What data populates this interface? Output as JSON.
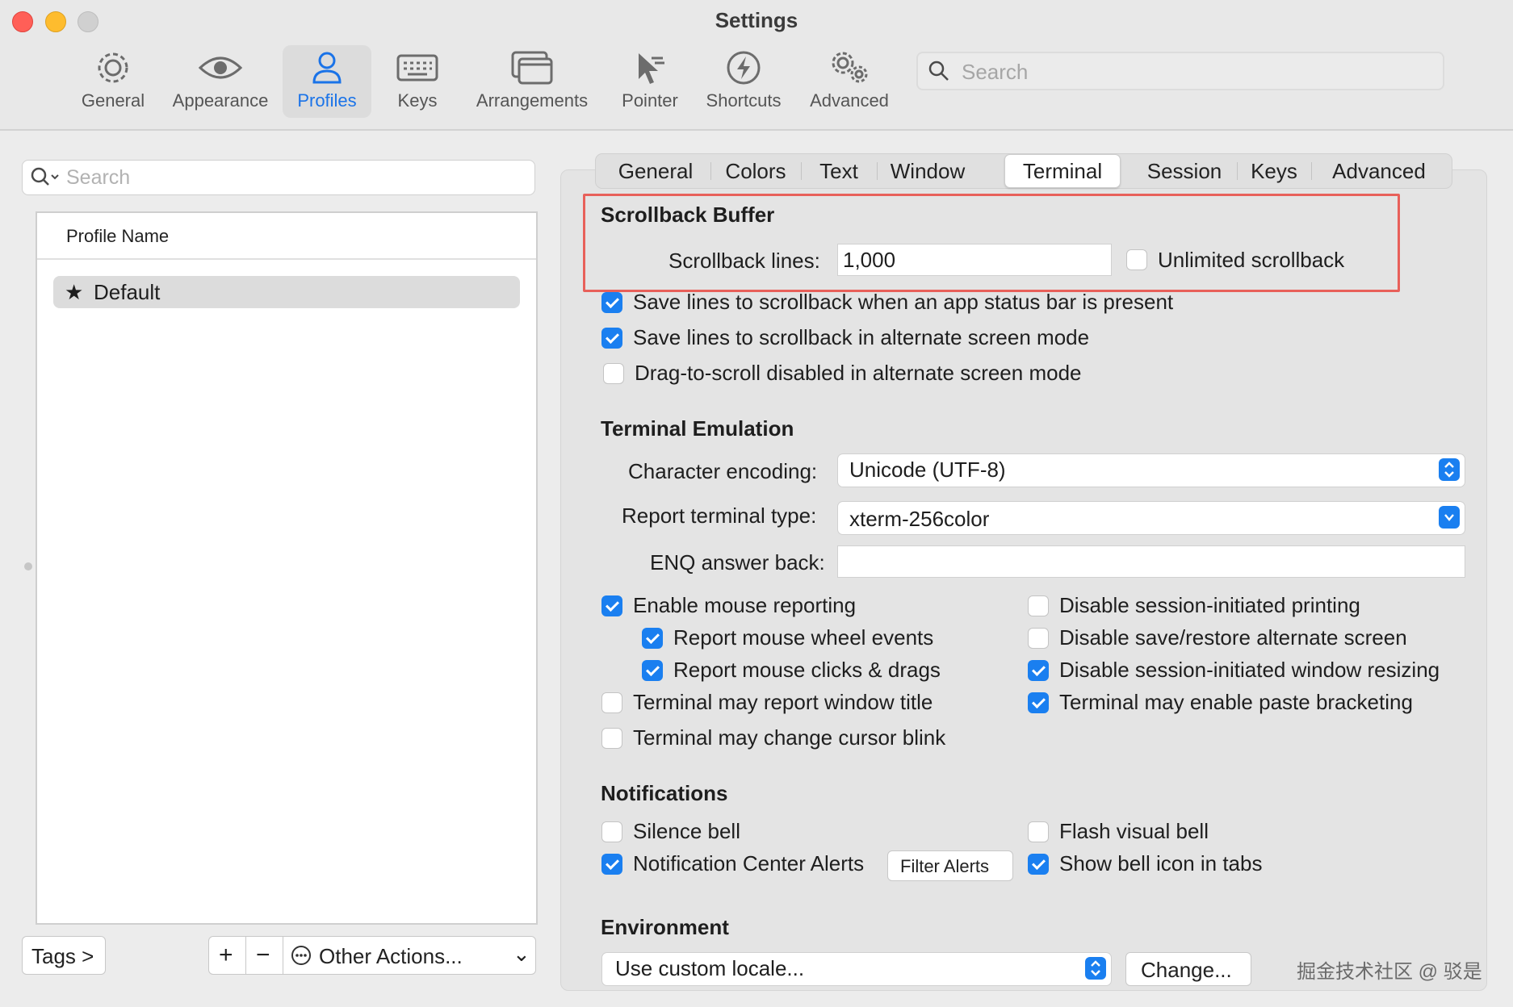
{
  "window": {
    "title": "Settings"
  },
  "toolbar": {
    "items": [
      {
        "label": "General",
        "icon": "gear-icon"
      },
      {
        "label": "Appearance",
        "icon": "eye-icon"
      },
      {
        "label": "Profiles",
        "icon": "person-icon",
        "selected": true
      },
      {
        "label": "Keys",
        "icon": "keyboard-icon"
      },
      {
        "label": "Arrangements",
        "icon": "windows-icon"
      },
      {
        "label": "Pointer",
        "icon": "cursor-icon"
      },
      {
        "label": "Shortcuts",
        "icon": "bolt-icon"
      },
      {
        "label": "Advanced",
        "icon": "gears-icon"
      }
    ],
    "search_placeholder": "Search"
  },
  "sidebar": {
    "search_placeholder": "Search",
    "column_header": "Profile Name",
    "profiles": [
      {
        "name": "Default",
        "default": true
      }
    ],
    "tags_label": "Tags >",
    "add_label": "+",
    "remove_label": "−",
    "other_actions_label": "Other Actions...",
    "other_actions_caret": "⌄"
  },
  "tabs": [
    "General",
    "Colors",
    "Text",
    "Window",
    "Terminal",
    "Session",
    "Keys",
    "Advanced"
  ],
  "selected_tab": "Terminal",
  "scrollback": {
    "title": "Scrollback Buffer",
    "lines_label": "Scrollback lines:",
    "lines_value": "1,000",
    "unlimited_label": "Unlimited scrollback",
    "unlimited_checked": false,
    "options": [
      {
        "label": "Save lines to scrollback when an app status bar is present",
        "checked": true
      },
      {
        "label": "Save lines to scrollback in alternate screen mode",
        "checked": true
      },
      {
        "label": "Drag-to-scroll disabled in alternate screen mode",
        "checked": false
      }
    ]
  },
  "emulation": {
    "title": "Terminal Emulation",
    "encoding_label": "Character encoding:",
    "encoding_value": "Unicode (UTF-8)",
    "type_label": "Report terminal type:",
    "type_value": "xterm-256color",
    "enq_label": "ENQ answer back:",
    "enq_value": "",
    "left_options": [
      {
        "label": "Enable mouse reporting",
        "checked": true
      },
      {
        "label": "Report mouse wheel events",
        "checked": true
      },
      {
        "label": "Report mouse clicks & drags",
        "checked": true
      },
      {
        "label": "Terminal may report window title",
        "checked": false
      },
      {
        "label": "Terminal may change cursor blink",
        "checked": false
      }
    ],
    "right_options": [
      {
        "label": "Disable session-initiated printing",
        "checked": false
      },
      {
        "label": "Disable save/restore alternate screen",
        "checked": false
      },
      {
        "label": "Disable session-initiated window resizing",
        "checked": true
      },
      {
        "label": "Terminal may enable paste bracketing",
        "checked": true
      }
    ]
  },
  "notifications": {
    "title": "Notifications",
    "silence_bell": {
      "label": "Silence bell",
      "checked": false
    },
    "flash_bell": {
      "label": "Flash visual bell",
      "checked": false
    },
    "center_alerts": {
      "label": "Notification Center Alerts",
      "checked": true
    },
    "filter_alerts_label": "Filter Alerts",
    "bell_icon": {
      "label": "Show bell icon in tabs",
      "checked": true
    }
  },
  "environment": {
    "title": "Environment",
    "locale_value": "Use custom locale...",
    "change_label": "Change..."
  },
  "watermark": "掘金技术社区 @ 驳是",
  "colors": {
    "accent": "#1a7ff0",
    "highlight_box": "#e8605a"
  }
}
